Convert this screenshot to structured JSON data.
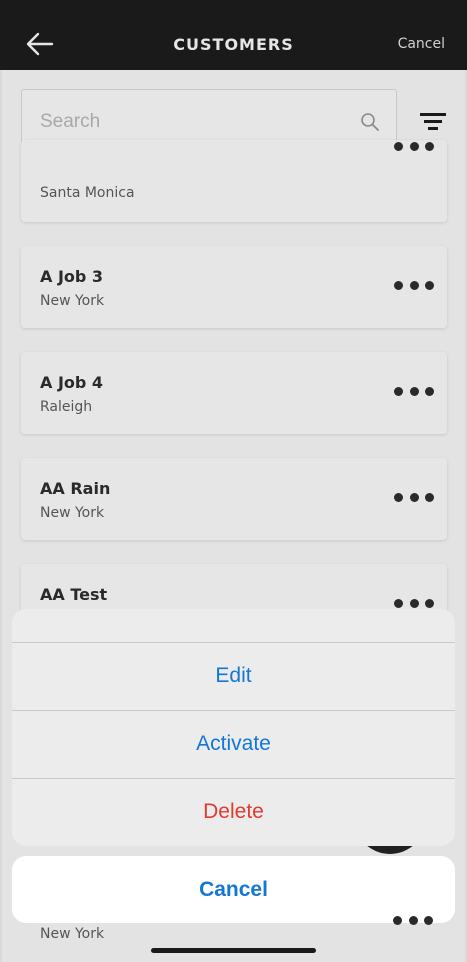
{
  "header": {
    "title": "CUSTOMERS",
    "cancel_label": "Cancel"
  },
  "search": {
    "placeholder": "Search"
  },
  "customers": [
    {
      "name": "",
      "city": "Santa Monica"
    },
    {
      "name": "A Job 3",
      "city": "New York"
    },
    {
      "name": "A Job 4",
      "city": "Raleigh"
    },
    {
      "name": "AA Rain",
      "city": "New York"
    },
    {
      "name": "AA Test",
      "city": ""
    }
  ],
  "action_sheet": {
    "edit_label": "Edit",
    "activate_label": "Activate",
    "delete_label": "Delete",
    "cancel_label": "Cancel"
  },
  "bottom_row": {
    "city": "New York"
  },
  "colors": {
    "action_blue": "#1577d4",
    "destructive_red": "#e03b30",
    "header_bg": "#1a1a1a"
  }
}
